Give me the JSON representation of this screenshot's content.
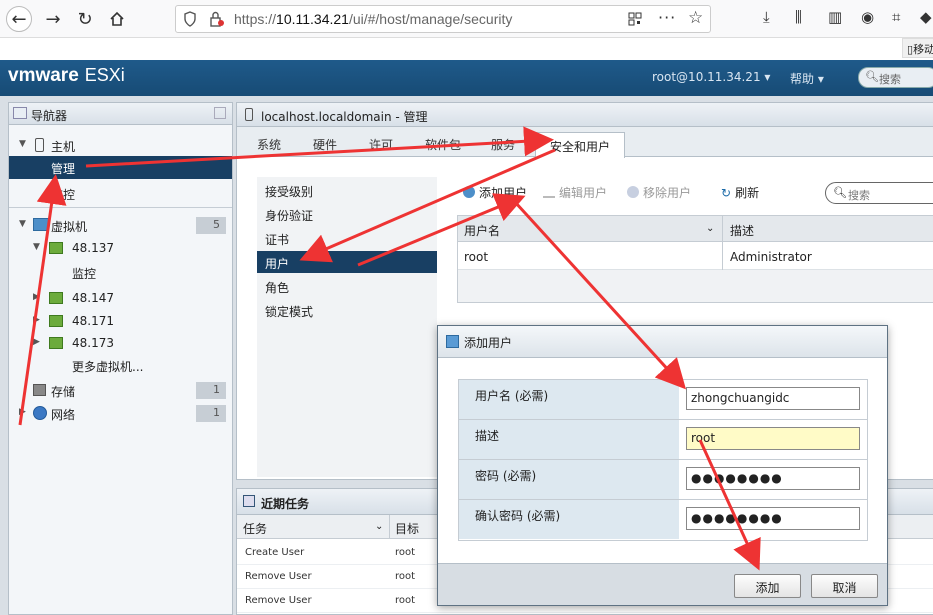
{
  "browser": {
    "url_host": "10.11.34.21",
    "url_prefix": "https://",
    "url_path": "/ui/#/host/manage/security",
    "mobile_badge": "移动"
  },
  "header": {
    "brand_vm": "vmware",
    "brand_product": "ESXi",
    "user": "root@10.11.34.21 ▾",
    "help": "帮助 ▾",
    "search_placeholder": "搜索"
  },
  "navigator": {
    "title": "导航器",
    "items": [
      {
        "label": "主机"
      },
      {
        "label": "管理"
      },
      {
        "label": "监控"
      },
      {
        "label": "虚拟机",
        "count": "5"
      },
      {
        "label": "48.137"
      },
      {
        "label": "监控"
      },
      {
        "label": "48.147"
      },
      {
        "label": "48.171"
      },
      {
        "label": "48.173"
      },
      {
        "label": "更多虚拟机..."
      },
      {
        "label": "存储",
        "count": "1"
      },
      {
        "label": "网络",
        "count": "1"
      }
    ]
  },
  "manage": {
    "title": "localhost.localdomain - 管理",
    "tabs": [
      "系统",
      "硬件",
      "许可",
      "软件包",
      "服务"
    ],
    "active_tab": "安全和用户",
    "submenu": [
      "接受级别",
      "身份验证",
      "证书",
      "用户",
      "角色",
      "锁定模式"
    ],
    "toolbar": {
      "add_user": "添加用户",
      "edit_user": "编辑用户",
      "remove_user": "移除用户",
      "refresh": "刷新",
      "search_placeholder": "搜索"
    },
    "grid": {
      "columns": [
        "用户名",
        "描述"
      ],
      "rows": [
        {
          "username": "root",
          "description": "Administrator"
        }
      ]
    }
  },
  "tasks": {
    "title": "近期任务",
    "columns": [
      "任务",
      "目标"
    ],
    "rows": [
      {
        "task": "Create User",
        "target": "root"
      },
      {
        "task": "Remove User",
        "target": "root"
      },
      {
        "task": "Remove User",
        "target": "root"
      }
    ]
  },
  "dialog": {
    "title": "添加用户",
    "fields": {
      "username_label": "用户名 (必需)",
      "username_value": "zhongchuangidc",
      "description_label": "描述",
      "description_value": "root",
      "password_label": "密码 (必需)",
      "password_value": "●●●●●●●●",
      "confirm_label": "确认密码 (必需)",
      "confirm_value": "●●●●●●●●"
    },
    "buttons": {
      "add": "添加",
      "cancel": "取消"
    }
  },
  "colors": {
    "header_bg": "#1f5a8a",
    "selected_bg": "#183f63",
    "annotation_red": "#ee3333",
    "description_warn_bg": "#fffbc7"
  }
}
